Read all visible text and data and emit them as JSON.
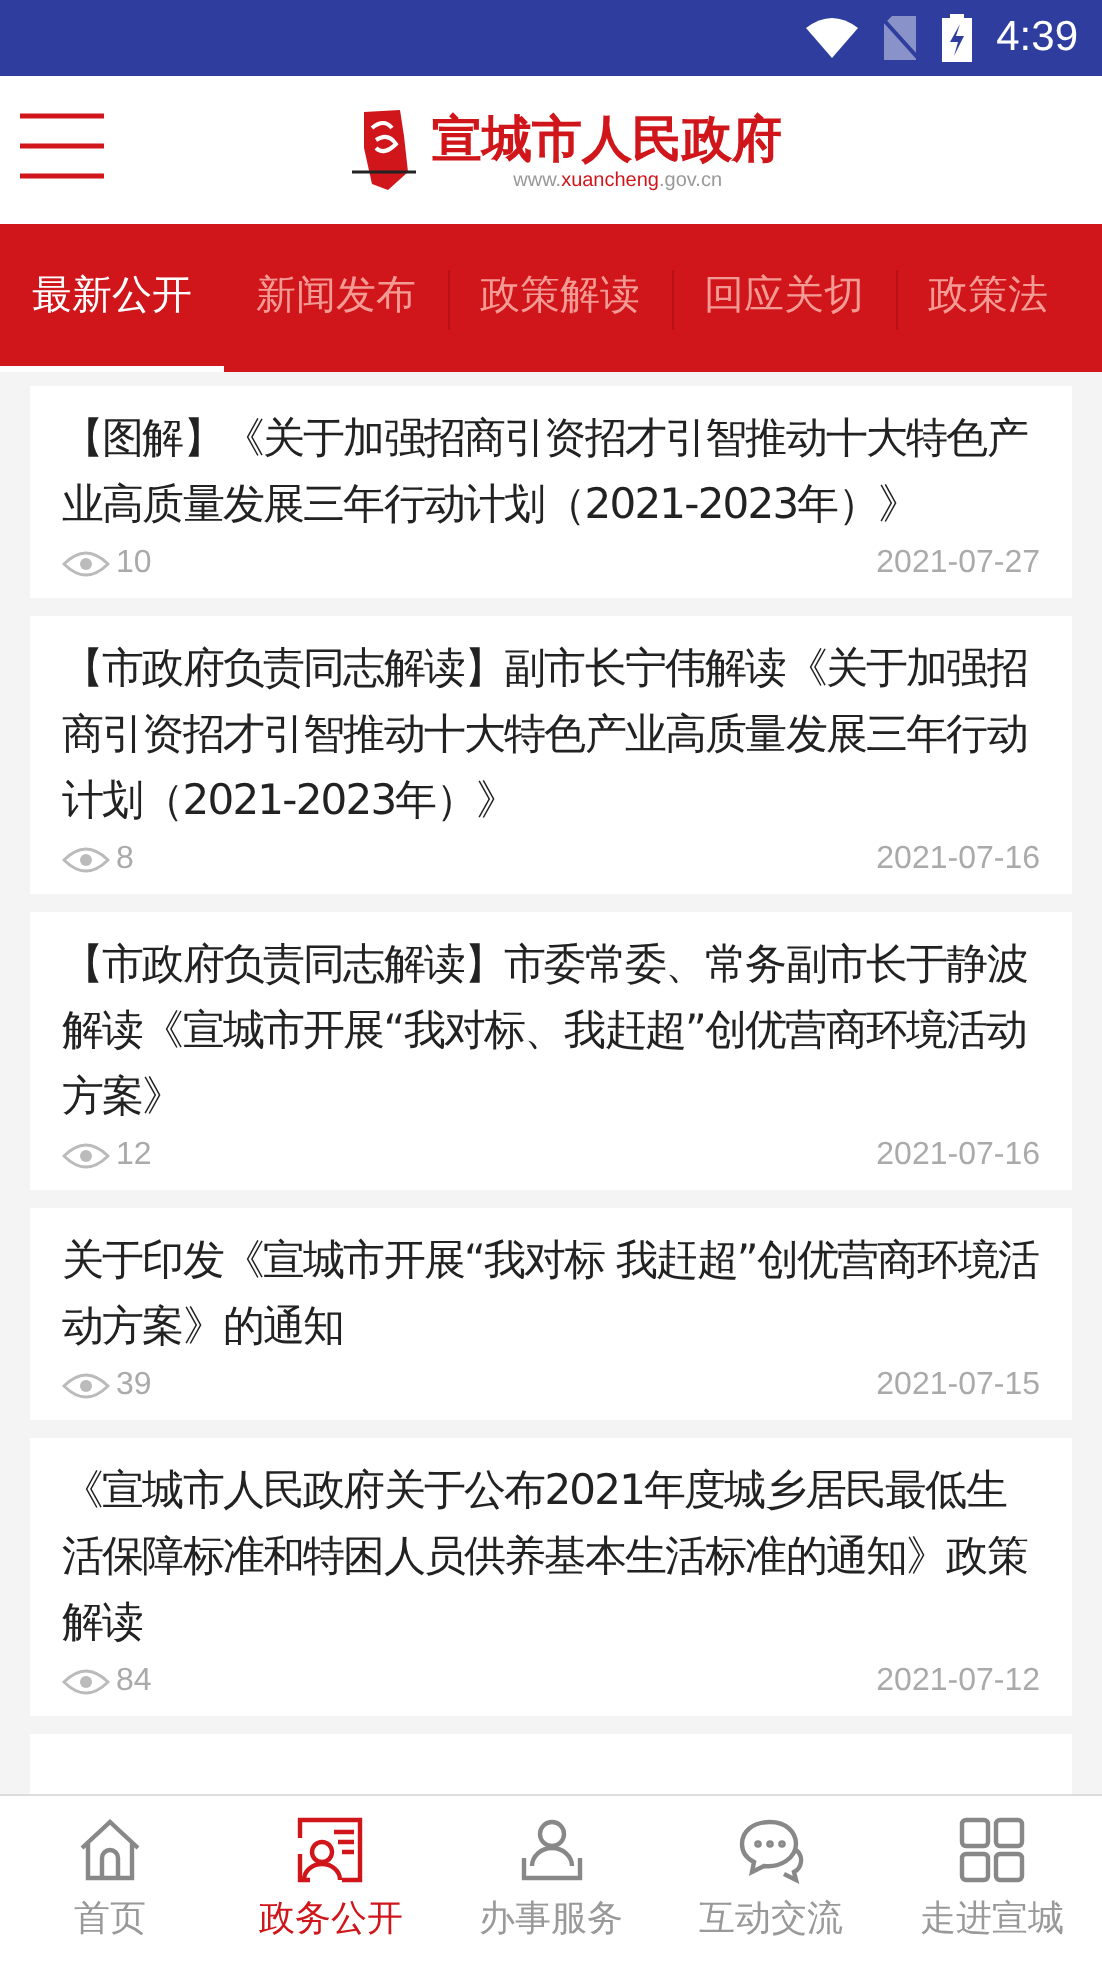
{
  "status_bar": {
    "time": "4:39"
  },
  "header": {
    "title": "宣城市人民政府",
    "url": [
      {
        "text": "www.",
        "highlight": false
      },
      {
        "text": "xuancheng",
        "highlight": true
      },
      {
        "text": ".gov.cn",
        "highlight": false
      }
    ]
  },
  "tabs": [
    {
      "label": "最新公开",
      "selected": true
    },
    {
      "label": "新闻发布",
      "selected": false
    },
    {
      "label": "政策解读",
      "selected": false
    },
    {
      "label": "回应关切",
      "selected": false
    },
    {
      "label": "政策法",
      "selected": false
    }
  ],
  "articles": [
    {
      "title": "【图解】《关于加强招商引资招才引智推动十大特色产业高质量发展三年行动计划（2021-2023年）》",
      "views": "10",
      "date": "2021-07-27"
    },
    {
      "title": "【市政府负责同志解读】副市长宁伟解读《关于加强招商引资招才引智推动十大特色产业高质量发展三年行动计划（2021-2023年）》",
      "views": "8",
      "date": "2021-07-16"
    },
    {
      "title": "【市政府负责同志解读】市委常委、常务副市长于静波解读《宣城市开展“我对标、我赶超”创优营商环境活动方案》",
      "views": "12",
      "date": "2021-07-16"
    },
    {
      "title": "关于印发《宣城市开展“我对标 我赶超”创优营商环境活动方案》的通知",
      "views": "39",
      "date": "2021-07-15"
    },
    {
      "title": "《宣城市人民政府关于公布2021年度城乡居民最低生活保障标准和特困人员供养基本生活标准的通知》政策解读",
      "views": "84",
      "date": "2021-07-12"
    }
  ],
  "bottom_nav": [
    {
      "label": "首页",
      "selected": false
    },
    {
      "label": "政务公开",
      "selected": true
    },
    {
      "label": "办事服务",
      "selected": false
    },
    {
      "label": "互动交流",
      "selected": false
    },
    {
      "label": "走进宣城",
      "selected": false
    }
  ]
}
